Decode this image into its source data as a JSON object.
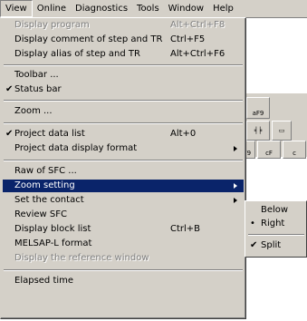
{
  "menubar": {
    "items": [
      "View",
      "Online",
      "Diagnostics",
      "Tools",
      "Window",
      "Help"
    ],
    "active": "View"
  },
  "toolbar": {
    "buttons": [
      "aF9",
      "sF9",
      "cF",
      "c"
    ]
  },
  "view_menu": {
    "items": [
      {
        "label": "Display program",
        "accel": "Alt+Ctrl+F8",
        "disabled": true
      },
      {
        "label": "Display comment of step and TR",
        "accel": "Ctrl+F5"
      },
      {
        "label": "Display alias of step and TR",
        "accel": "Alt+Ctrl+F6"
      },
      {
        "label": "Toolbar ..."
      },
      {
        "label": "Status bar",
        "checked": true,
        "check": "✔"
      },
      {
        "label": "Zoom ..."
      },
      {
        "label": "Project data list",
        "accel": "Alt+0",
        "checked": true,
        "check": "✔"
      },
      {
        "label": "Project data display format",
        "submenu": true
      },
      {
        "label": "Raw of SFC ..."
      },
      {
        "label": "Zoom setting",
        "submenu": true,
        "selected": true
      },
      {
        "label": "Set the contact",
        "submenu": true
      },
      {
        "label": "Review SFC"
      },
      {
        "label": "Display block list",
        "accel": "Ctrl+B"
      },
      {
        "label": "MELSAP-L format"
      },
      {
        "label": "Display the reference window",
        "disabled": true
      },
      {
        "label": "Elapsed time"
      }
    ]
  },
  "zoom_submenu": {
    "items": [
      {
        "label": "Below"
      },
      {
        "label": "Right",
        "bullet": "•"
      },
      {
        "label": "Split",
        "checked": true,
        "check": "✔"
      }
    ]
  }
}
